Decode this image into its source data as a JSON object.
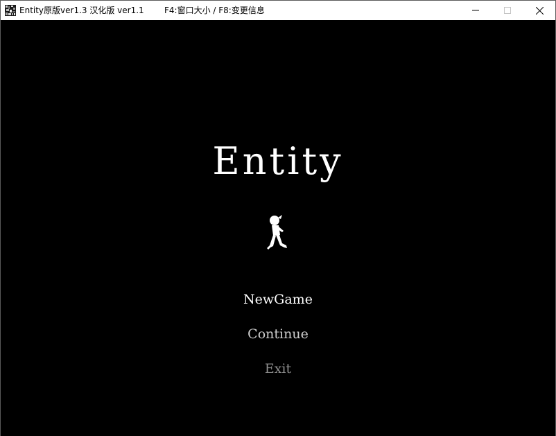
{
  "window": {
    "title": "Entity原版ver1.3 汉化版 ver1.1",
    "hint": "F4:窗口大小 / F8:变更信息",
    "icon": "app-icon"
  },
  "game": {
    "title": "Entity",
    "mascot_icon": "running-child-icon"
  },
  "menu": {
    "items": [
      {
        "label": "NewGame"
      },
      {
        "label": "Continue"
      },
      {
        "label": "Exit"
      }
    ]
  },
  "colors": {
    "background": "#000000",
    "text_primary": "#ffffff",
    "text_secondary": "#cfcfcf",
    "text_disabled": "#8c8c8c"
  }
}
